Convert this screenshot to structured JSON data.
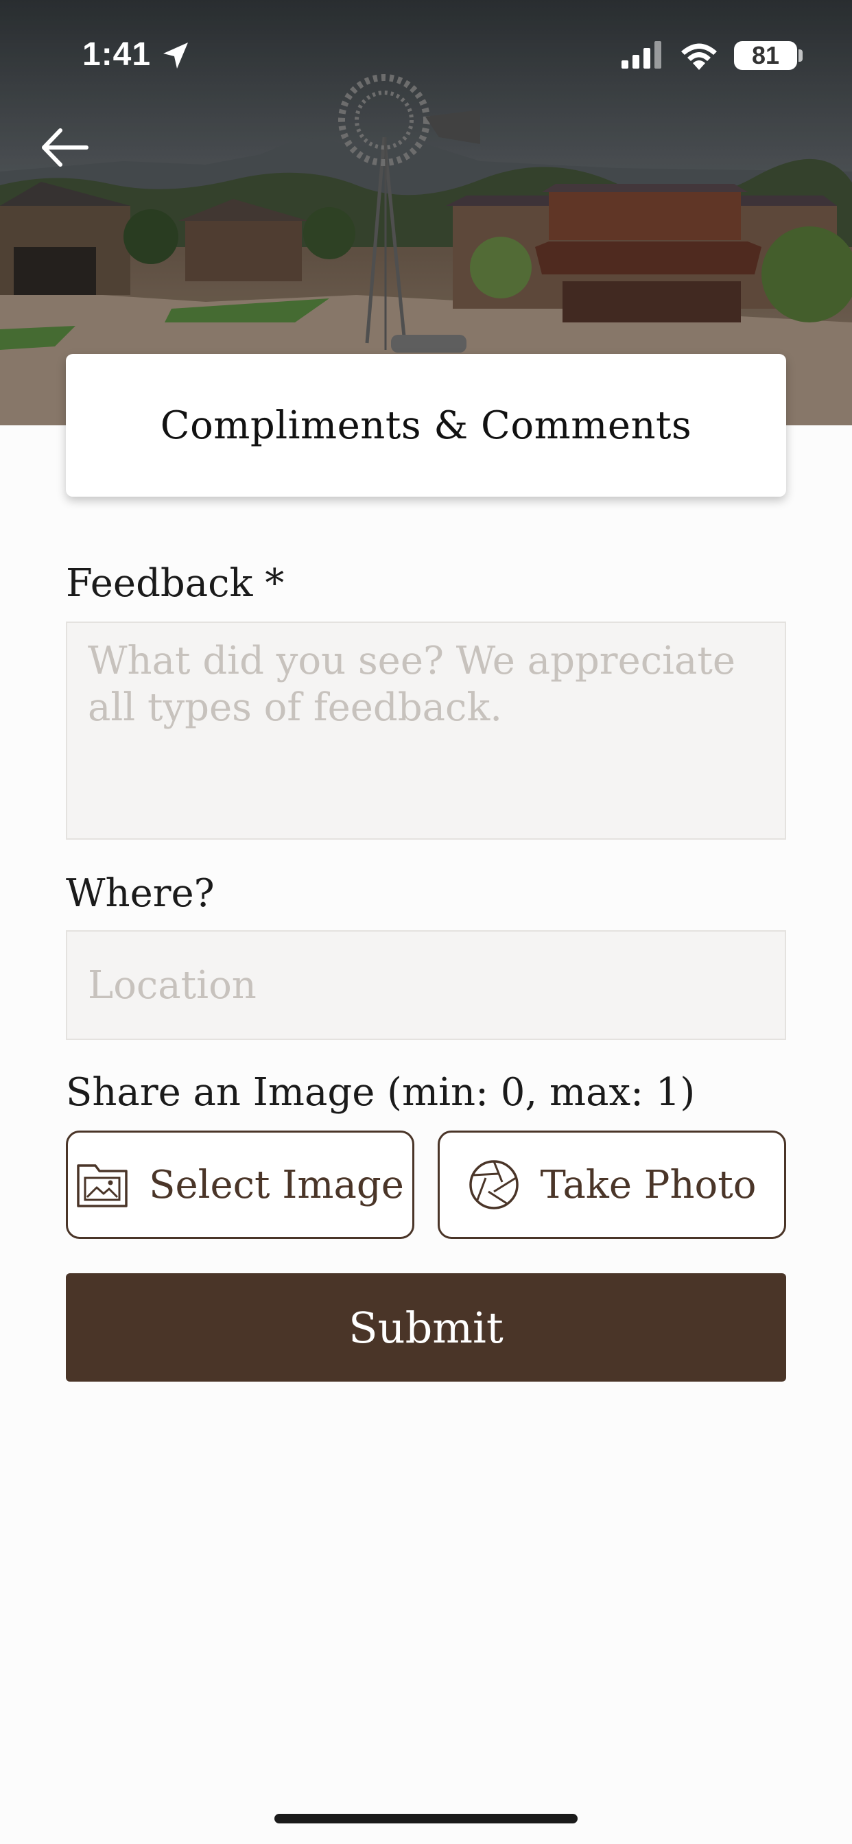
{
  "status_bar": {
    "time": "1:41",
    "battery": "81"
  },
  "icons": {
    "back": "arrow-left-icon",
    "location": "location-arrow-icon",
    "signal": "cellular-signal-icon",
    "wifi": "wifi-icon",
    "battery": "battery-icon",
    "select_image": "image-folder-icon",
    "take_photo": "camera-shutter-icon"
  },
  "header": {
    "title": "Compliments & Comments"
  },
  "form": {
    "feedback_label": "Feedback *",
    "feedback_placeholder": "What did you see? We appreciate all types of feedback.",
    "where_label": "Where?",
    "where_placeholder": "Location",
    "image_label": "Share an Image (min: 0, max: 1)",
    "select_image_label": "Select Image",
    "take_photo_label": "Take Photo",
    "submit_label": "Submit"
  },
  "colors": {
    "accent": "#4a3528",
    "field_bg": "#f5f4f3",
    "placeholder": "#c7c2bd",
    "background": "#fcfcfc"
  }
}
